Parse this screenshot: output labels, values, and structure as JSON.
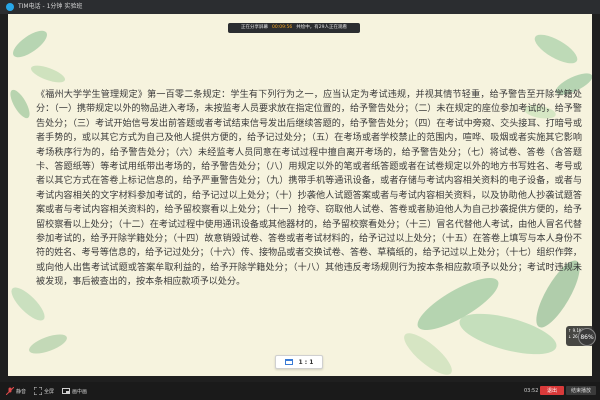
{
  "window": {
    "title": "TIM电话 - 1分钟 实验班"
  },
  "banner": {
    "status": "正在分享屏幕",
    "time": "00:09:56",
    "note": "共绘中，有29人正在观看"
  },
  "document": {
    "text": "《福州大学学生管理规定》第一百零二条规定：学生有下列行为之一，应当认定为考试违规，并视其情节轻重，给予警告至开除学籍处分：（一）携带规定以外的物品进入考场，未按监考人员要求放在指定位置的，给予警告处分；（二）未在规定的座位参加考试的，给予警告处分；（三）考试开始信号发出前答题或者考试结束信号发出后继续答题的，给予警告处分；（四）在考试中旁窥、交头接耳、打暗号或者手势的，或以其它方式为自己及他人提供方便的，给予记过处分；（五）在考场或者学校禁止的范围内，喧哗、吸烟或者实施其它影响考场秩序行为的，给予警告处分；（六）未经监考人员同意在考试过程中擅自离开考场的，给予警告处分；（七）将试卷、答卷（含答题卡、答题纸等）等考试用纸带出考场的，给予警告处分；（八）用规定以外的笔或者纸答题或者在试卷规定以外的地方书写姓名、考号或者以其它方式在答卷上标记信息的，给予严重警告处分；（九）携带手机等通讯设备，或者存储与考试内容相关资料的电子设备，或者与考试内容相关的文字材料参加考试的，给予记过以上处分；（十）抄袭他人试题答案或者与考试内容相关资料，以及协助他人抄袭试题答案或者与考试内容相关资料的，给予留校察看以上处分；（十一）抢夺、窃取他人试卷、答卷或者胁迫他人为自己抄袭提供方便的，给予留校察看以上处分；（十二）在考试过程中使用通讯设备或其他器材的，给予留校察看处分；（十三）冒名代替他人考试，由他人冒名代替参加考试的，给予开除学籍处分；（十四）故意销毁试卷、答卷或者考试材料的，给予记过以上处分；（十五）在答卷上填写与本人身份不符的姓名、考号等信息的，给予记过处分；（十六）传、接物品或者交换试卷、答卷、草稿纸的，给予记过以上处分；（十七）组织作弊，或向他人出售考试试题或答案牟取利益的，给予开除学籍处分；（十八）其他违反考场规则行为按本条相应款项予以处分；考试时违规未被发现，事后被查出的，按本条相应款项予以处分。"
  },
  "zoom": {
    "label": "1 : 1"
  },
  "network": {
    "up": "↑ 9.1K/s",
    "down": "↓ 26.2K/s",
    "percent": "86%"
  },
  "taskbar": {
    "items": [
      {
        "label": "静音"
      },
      {
        "label": "全屏"
      },
      {
        "label": "画中画"
      }
    ],
    "clock": "03:52",
    "stop": "退出",
    "end": "结束播放"
  },
  "colors": {
    "background": "#f6f3de",
    "titlebar": "#2b2d30",
    "accent": "#27a7e8",
    "stop": "#d93a3a"
  }
}
